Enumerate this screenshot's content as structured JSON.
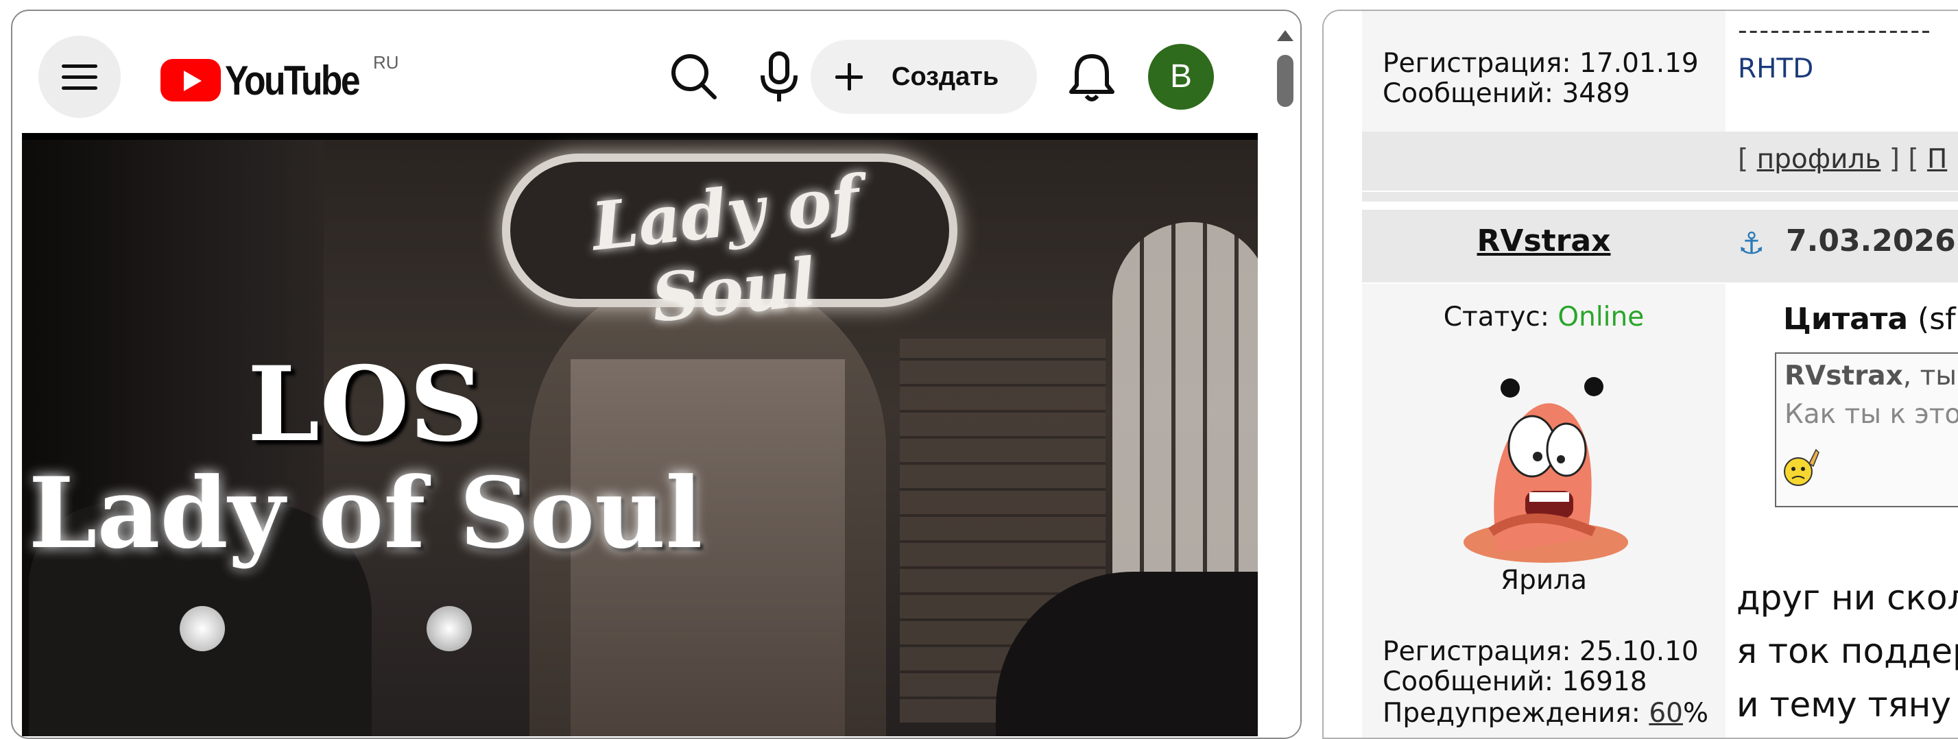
{
  "youtube": {
    "logo_text": "YouTube",
    "region": "RU",
    "create_label": "Создать",
    "avatar_letter": "B",
    "video": {
      "sign_text": "Lady of Soul",
      "title_line1": "LOS",
      "title_line2": "Lady of Soul"
    }
  },
  "forum": {
    "prev_post": {
      "dashes": "------------------",
      "registration": "Регистрация: 17.01.19",
      "messages": "Сообщений: 3489",
      "signature": "RHTD",
      "links_prefix": "[ ",
      "profile_link": "профиль",
      "links_mid": " ] [ ",
      "next_link": "П"
    },
    "post": {
      "username": "RVstrax",
      "date": "7.03.2026",
      "status_label": "Статус: ",
      "status_value": "Online",
      "rank": "Ярила",
      "registration": "Регистрация: 25.10.10",
      "messages": "Сообщений: 16918",
      "warnings_label": "Предупреждения: ",
      "warnings_value": "60",
      "warnings_suffix": "%",
      "quote_header": "Цитата",
      "quote_header_rest": " (sf",
      "quote_author": "RVstrax",
      "quote_author_rest": ", ты",
      "quote_line": "Как ты к это",
      "body_lines": [
        "друг ни скол",
        "я ток поддер",
        "и тему тяну"
      ]
    }
  },
  "colors": {
    "online": "#2aa52a",
    "youtube_red": "#ff0000",
    "avatar_bg": "#2e6b1c",
    "link_blue": "#1a3a7a"
  }
}
